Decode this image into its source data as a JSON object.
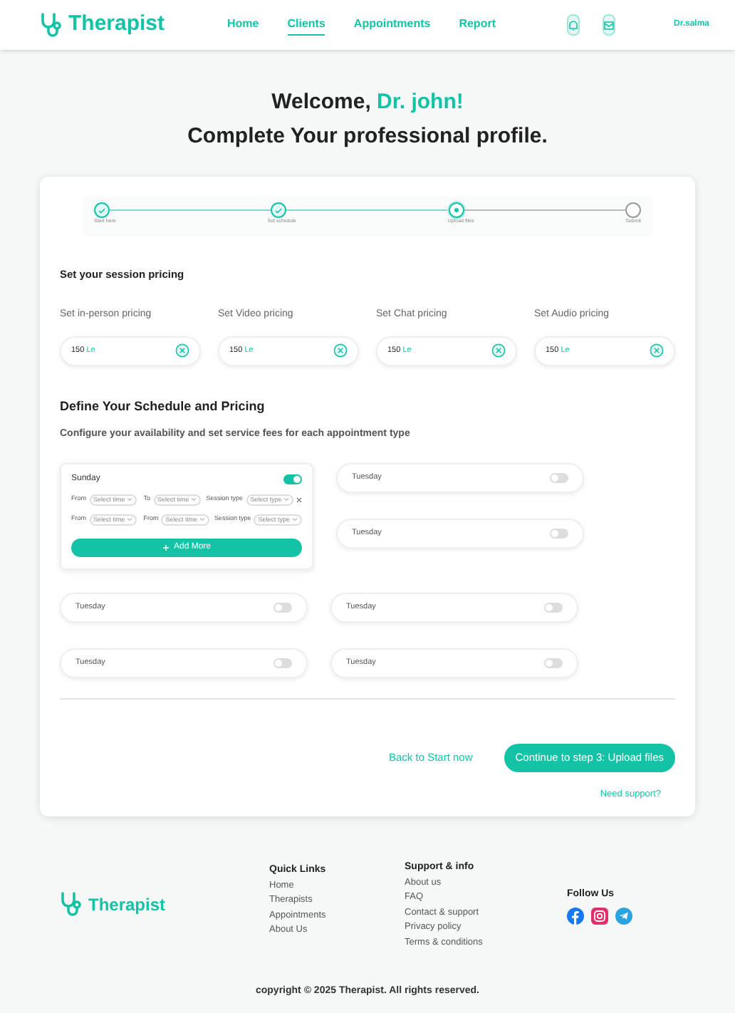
{
  "header": {
    "brand": "Therapist",
    "nav": [
      {
        "label": "Home",
        "selected": false
      },
      {
        "label": "Clients",
        "selected": true
      },
      {
        "label": "Appointments",
        "selected": false
      },
      {
        "label": "Report",
        "selected": false
      }
    ],
    "user": "Dr.salma"
  },
  "welcome": {
    "greeting": "Welcome, ",
    "name": "Dr. john!",
    "subtitle": "Complete Your professional profile."
  },
  "stepper": [
    {
      "label": "Start here",
      "completed": true,
      "current": false
    },
    {
      "label": "Set schedule",
      "completed": true,
      "current": false
    },
    {
      "label": "Upload files",
      "completed": false,
      "current": true
    },
    {
      "label": "Submit",
      "completed": false,
      "current": false
    }
  ],
  "pricing": {
    "title": "Set your session pricing",
    "fields": [
      {
        "label": "Set in-person pricing",
        "value": "150",
        "unit": "Le"
      },
      {
        "label": "Set Video pricing",
        "value": "150",
        "unit": "Le"
      },
      {
        "label": "Set Chat pricing",
        "value": "150",
        "unit": "Le"
      },
      {
        "label": "Set Audio pricing",
        "value": "150",
        "unit": "Le"
      }
    ]
  },
  "schedule": {
    "title": "Define Your Schedule and Pricing",
    "subtitle": "Configure your availability and set service fees for each appointment type",
    "open_day": {
      "day": "Sunday",
      "on": true,
      "rows": [
        {
          "fields": [
            {
              "label": "From",
              "placeholder": "Select time"
            },
            {
              "label": "To",
              "placeholder": "Select time"
            },
            {
              "label": "Session type",
              "placeholder": "Select type"
            }
          ]
        },
        {
          "fields": [
            {
              "label": "From",
              "placeholder": "Select time"
            },
            {
              "label": "From",
              "placeholder": "Select time"
            },
            {
              "label": "Session type",
              "placeholder": "Select type"
            }
          ]
        }
      ],
      "add_button": "Add More"
    },
    "side_days": [
      {
        "day": "Tuesday",
        "on": false
      },
      {
        "day": "Tuesday",
        "on": false
      }
    ],
    "days": [
      {
        "day": "Tuesday",
        "on": false
      },
      {
        "day": "Tuesday",
        "on": false
      },
      {
        "day": "Tuesday",
        "on": false
      },
      {
        "day": "Tuesday",
        "on": false
      }
    ]
  },
  "actions": {
    "back": "Back to Start now",
    "next": "Continue to step 3: Upload files",
    "support": "Need support?"
  },
  "footer": {
    "brand": "Therapist",
    "columns": [
      {
        "title": "Quick Links",
        "links": [
          "Home",
          "Therapists",
          "Appointments",
          "About Us"
        ]
      },
      {
        "title": "Support & info",
        "links": [
          "About us",
          "FAQ",
          "Contact & support",
          "Privacy policy",
          "Terms & conditions"
        ]
      }
    ],
    "follow": "Follow Us",
    "copyright": "copyright © 2025 Therapist. All rights reserved."
  }
}
